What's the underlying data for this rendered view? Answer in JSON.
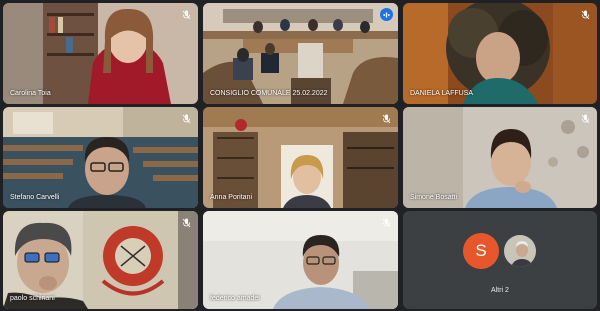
{
  "participants": [
    {
      "name": "Carolina Toia"
    },
    {
      "name": "CONSIGLIO COMUNALE 25.02.2022"
    },
    {
      "name": "DANIELA LAFFUSA"
    },
    {
      "name": "Stefano Carvelli"
    },
    {
      "name": "Anna Poritani"
    },
    {
      "name": "Simone Bosatti"
    },
    {
      "name": "paolo schiriani"
    },
    {
      "name": "federico amadei"
    }
  ],
  "others": {
    "avatar_letter": "S",
    "avatar_color": "#e8572c",
    "label": "Altri 2"
  },
  "colors": {
    "background": "#202124",
    "tile": "#3c4043",
    "active_outline": "#8ab4f8",
    "speaking_badge": "#1a73e8"
  },
  "icons": {
    "muted": "mic-off-icon",
    "speaking": "audio-level-icon"
  }
}
